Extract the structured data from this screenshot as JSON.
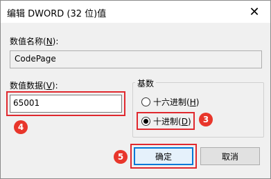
{
  "window": {
    "title": "编辑 DWORD (32 位)值",
    "close_glyph": "✕"
  },
  "value_name": {
    "label_prefix": "数值名称(",
    "label_key": "N",
    "label_suffix": "):",
    "value": "CodePage"
  },
  "value_data": {
    "label_prefix": "数值数据(",
    "label_key": "V",
    "label_suffix": "):",
    "value": "65001"
  },
  "base": {
    "title": "基数",
    "options": [
      {
        "prefix": "十六进制(",
        "key": "H",
        "suffix": ")",
        "checked": false
      },
      {
        "prefix": "十进制(",
        "key": "D",
        "suffix": ")",
        "checked": true
      }
    ]
  },
  "buttons": {
    "ok": "确定",
    "cancel": "取消"
  },
  "annotations": {
    "step3": "3",
    "step4": "4",
    "step5": "5",
    "color": "#e8362b"
  }
}
